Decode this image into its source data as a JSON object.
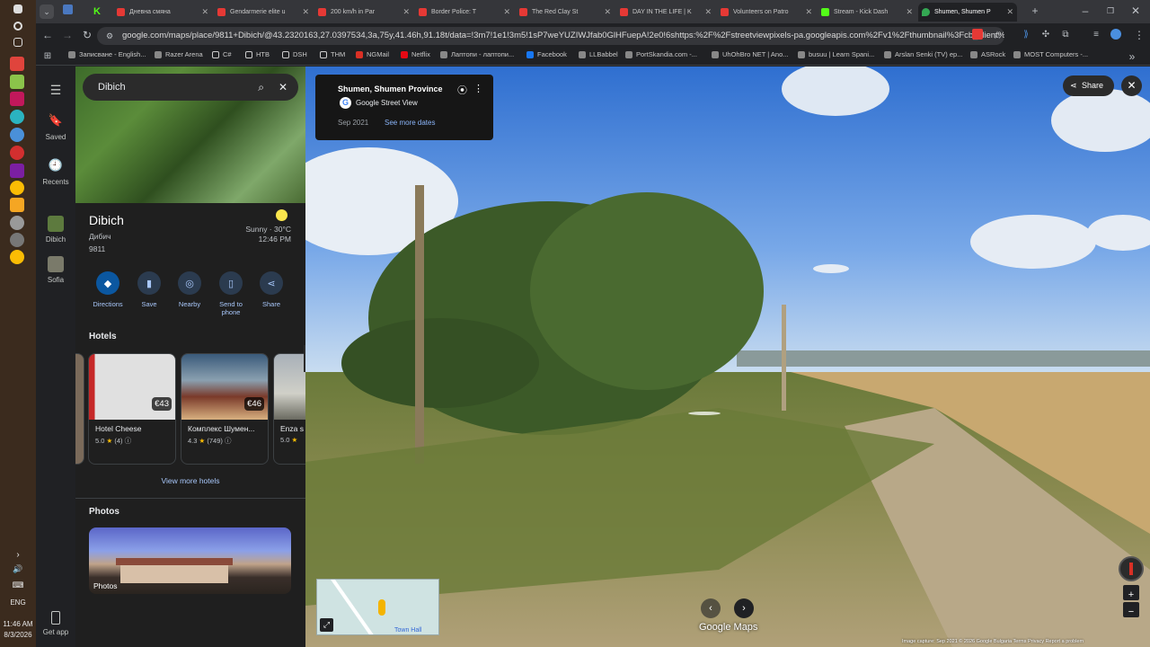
{
  "taskbar": {
    "language": "ENG",
    "time": "11:46 AM",
    "date": "8/3/2026"
  },
  "browser": {
    "tabs": [
      {
        "title": "Дневна смяна"
      },
      {
        "title": "Gendarmerie elite u"
      },
      {
        "title": "200 km/h in Par"
      },
      {
        "title": "Border Police: T"
      },
      {
        "title": "The Red Clay St"
      },
      {
        "title": "DAY IN THE LIFE | K"
      },
      {
        "title": "Volunteers on Patro"
      },
      {
        "title": "Stream - Kick Dash"
      },
      {
        "title": "Shumen, Shumen P"
      }
    ],
    "url": "google.com/maps/place/9811+Dibich/@43.2320163,27.0397534,3a,75y,41.46h,91.18t/data=!3m7!1e1!3m5!1sP7weYUZIWJfab0GlHFuepA!2e0!6shttps:%2F%2Fstreetviewpixels-pa.googleapis.com%2Fv1%2Fthumbnail%3Fcb_client%3Dmaps_sv.t...",
    "bookmarks": [
      "Записване - English...",
      "Razer Arena",
      "C#",
      "НТВ",
      "DSH",
      "THM",
      "NGMail",
      "Netflix",
      "Лаптопи - лаптопи...",
      "Facebook",
      "LLBabbel",
      "PortSkandia.com -...",
      "UhOhBro NET | Ano...",
      "busuu | Learn Spani...",
      "Arslan Senki (TV) ep...",
      "ASRock",
      "MOST Computers -..."
    ]
  },
  "rail": {
    "items": [
      {
        "label": "Saved"
      },
      {
        "label": "Recents"
      },
      {
        "label": "Dibich"
      },
      {
        "label": "Sofia"
      }
    ],
    "get_app": "Get app"
  },
  "panel": {
    "search": "Dibich",
    "title": "Dibich",
    "alt_name": "Дибич",
    "zip": "9811",
    "weather": "Sunny · 30°C",
    "local_time": "12:46 PM",
    "actions": [
      {
        "label": "Directions"
      },
      {
        "label": "Save"
      },
      {
        "label": "Nearby"
      },
      {
        "label": "Send to phone"
      },
      {
        "label": "Share"
      }
    ],
    "hotels_heading": "Hotels",
    "hotels": [
      {
        "name": "Hotel Cheese",
        "price": "€43",
        "rating": "5.0",
        "reviews": "(4)"
      },
      {
        "name": "Комплекс Шумен...",
        "price": "€46",
        "rating": "4.3",
        "reviews": "(749)"
      },
      {
        "name": "Enza s",
        "price": "",
        "rating": "5.0",
        "reviews": ""
      }
    ],
    "more_hotels": "View more hotels",
    "photos_heading": "Photos",
    "photos_label": "Photos"
  },
  "streetview": {
    "title": "Shumen, Shumen Province",
    "source": "Google Street View",
    "date": "Sep 2021",
    "more_dates": "See more dates",
    "share": "Share",
    "logo": "Google Maps",
    "footer": "Image capture: Sep 2021   © 2026 Google   Bulgaria   Terms   Privacy   Report a problem",
    "minimap_label": "Town Hall"
  }
}
